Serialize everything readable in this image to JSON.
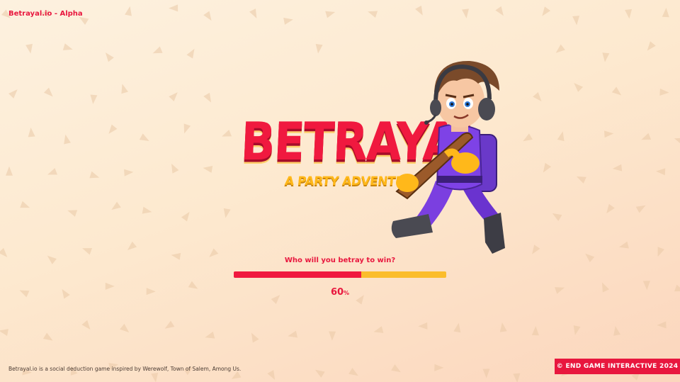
{
  "app": {
    "title": "Betrayal.io - Alpha"
  },
  "logo": {
    "main": "BETRAYAL",
    "subtitle": "A PARTY ADVENTURE"
  },
  "loading": {
    "tagline": "Who will you betray to win?",
    "progress": 60,
    "progress_text": "60",
    "unit": "%"
  },
  "footer": {
    "description": "Betrayal.io is a social deduction game inspired by Werewolf, Town of Salem, Among Us.",
    "copyright": "© END GAME INTERACTIVE 2024"
  },
  "colors": {
    "accent": "#e8173e",
    "bar_track": "#fbbd2c",
    "background": "#fdf1df"
  },
  "icons": {
    "background_pattern": "triangle-icon",
    "hero": "character-illustration"
  }
}
